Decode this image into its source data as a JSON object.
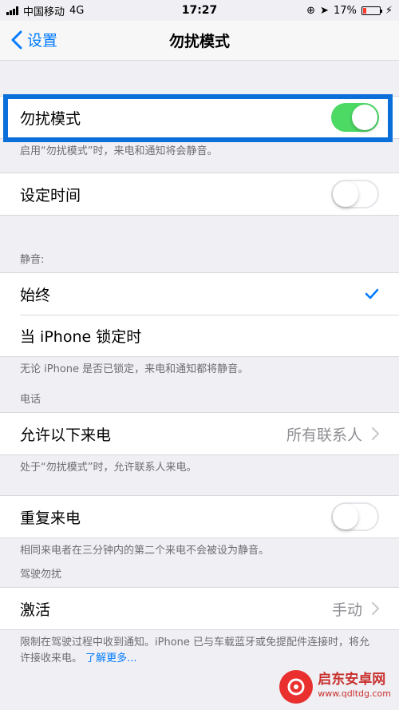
{
  "status_bar": {
    "carrier": "中国移动",
    "network": "4G",
    "time": "17:27",
    "battery": "17%"
  },
  "nav": {
    "back_label": "设置",
    "title": "勿扰模式"
  },
  "dnd": {
    "label": "勿扰模式",
    "on": true,
    "footnote": "启用“勿扰模式”时，来电和通知将会静音。"
  },
  "scheduled": {
    "label": "设定时间",
    "on": false
  },
  "silence": {
    "header": "静音:",
    "always": "始终",
    "locked": "当 iPhone 锁定时",
    "footnote": "无论 iPhone 是否已锁定，来电和通知都将静音。"
  },
  "phone": {
    "header": "电话",
    "allow_calls": "允许以下来电",
    "allow_calls_value": "所有联系人",
    "allow_footnote": "处于“勿扰模式”时，允许联系人来电。",
    "repeated": "重复来电",
    "repeated_on": false,
    "repeated_footnote": "相同来电者在三分钟内的第二个来电不会被设为静音。"
  },
  "driving": {
    "header": "驾驶勿扰",
    "activate": "激活",
    "activate_value": "手动",
    "footnote": "限制在驾驶过程中收到通知。iPhone 已与车载蓝牙或免提配件连接时，将允许接收来电。",
    "learn_more": "了解更多..."
  },
  "watermark": {
    "title": "启东安卓网",
    "url": "www.qdltdg.com"
  },
  "colors": {
    "accent": "#007aff",
    "toggle_on": "#4cd964",
    "highlight": "#0a6fd8"
  }
}
